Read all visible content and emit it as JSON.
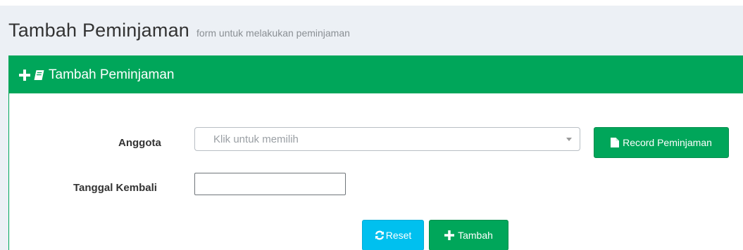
{
  "header": {
    "title": "Tambah Peminjaman",
    "subtitle": "form untuk melakukan peminjaman"
  },
  "panel": {
    "title": "Tambah Peminjaman",
    "icons": [
      "plus-icon",
      "book-icon"
    ]
  },
  "form": {
    "anggota_label": "Anggota",
    "anggota_placeholder": "Klik untuk memilih",
    "tanggal_label": "Tanggal Kembali",
    "tanggal_value": ""
  },
  "buttons": {
    "record_label": "Record Peminjaman",
    "reset_label": "Reset",
    "add_label": "Tambah"
  },
  "colors": {
    "primary_green": "#00a65a",
    "info_cyan": "#00c0ef",
    "content_bg": "#ecf0f5"
  }
}
